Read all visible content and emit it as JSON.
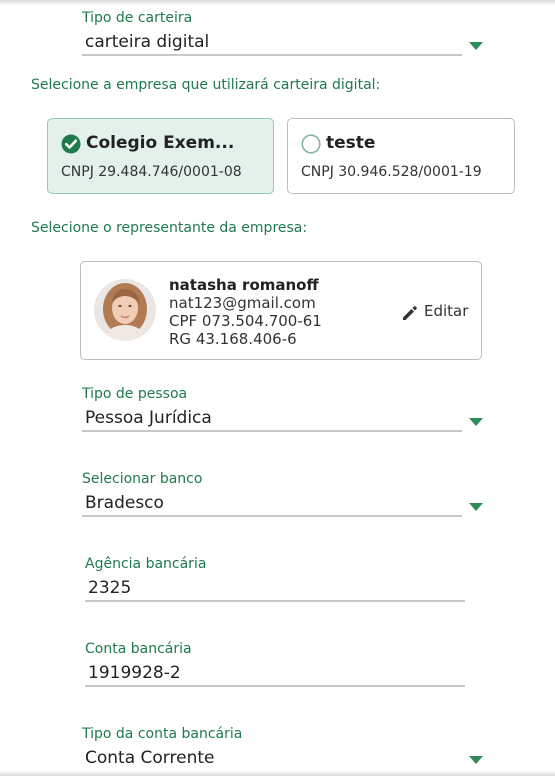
{
  "wallet_type": {
    "label": "Tipo de carteira",
    "value": "carteira digital"
  },
  "company_section": {
    "label": "Selecione a empresa que utilizará carteira digital:",
    "companies": [
      {
        "name": "Colegio Exem...",
        "cnpj": "CNPJ 29.484.746/0001-08",
        "selected": true
      },
      {
        "name": "teste",
        "cnpj": "CNPJ 30.946.528/0001-19",
        "selected": false
      }
    ]
  },
  "representative_section": {
    "label": "Selecione o representante da empresa:",
    "name": "natasha romanoff",
    "email": "nat123@gmail.com",
    "cpf": "CPF 073.504.700-61",
    "rg": "RG 43.168.406-6",
    "edit_label": "Editar"
  },
  "person_type": {
    "label": "Tipo de pessoa",
    "value": "Pessoa Jurídica"
  },
  "bank": {
    "label": "Selecionar banco",
    "value": "Bradesco"
  },
  "agency": {
    "label": "Agência bancária",
    "value": "2325"
  },
  "account": {
    "label": "Conta bancária",
    "value": "1919928-2"
  },
  "account_type": {
    "label": "Tipo da conta bancária",
    "value": "Conta Corrente"
  },
  "colors": {
    "accent": "#2e8b57",
    "label_green": "#1f7a4d",
    "selected_card_bg": "#e4f1ea"
  }
}
